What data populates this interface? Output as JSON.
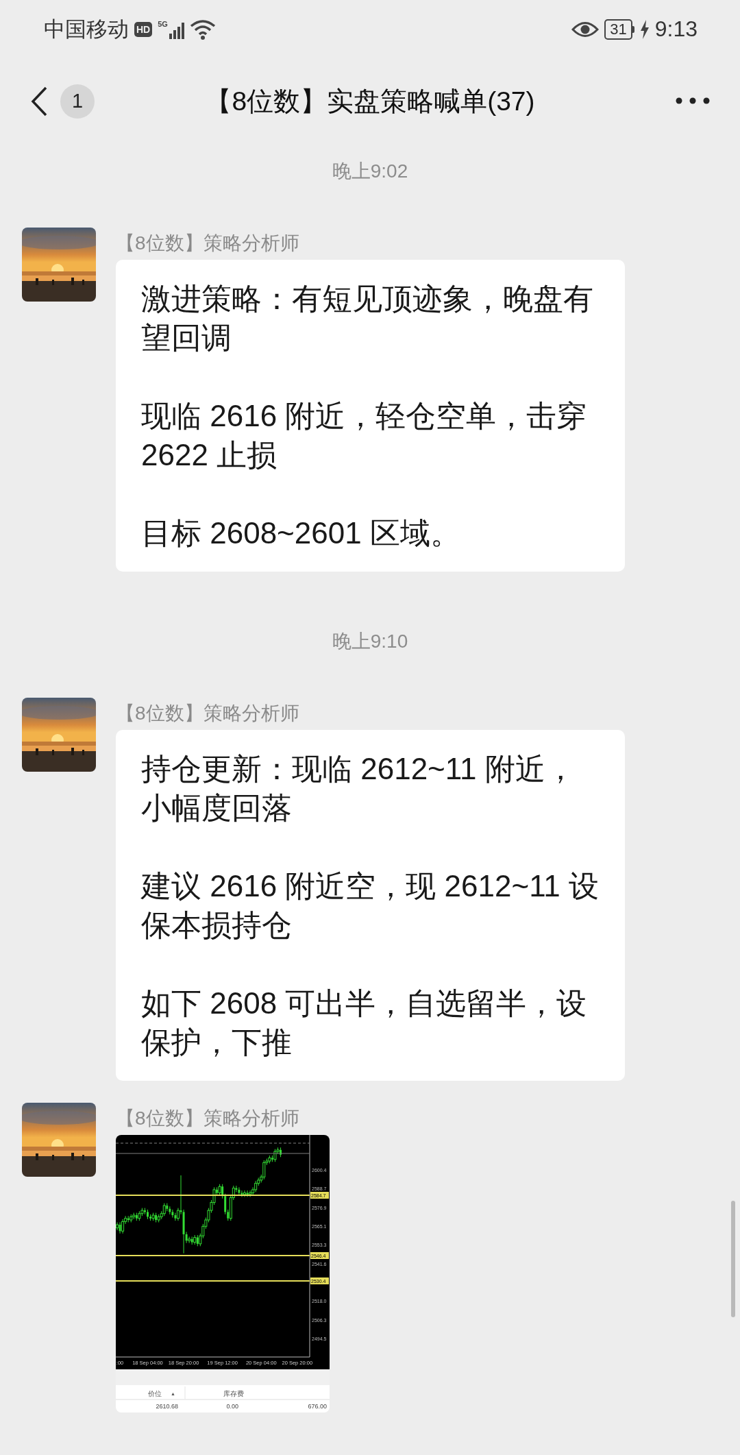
{
  "status_bar": {
    "carrier": "中国移动",
    "hd_badge": "HD",
    "network": "5G",
    "battery": "31",
    "time": "9:13"
  },
  "header": {
    "back_badge": "1",
    "title": "【8位数】实盘策略喊单(37)"
  },
  "messages": [
    {
      "kind": "time",
      "text": "晚上9:02"
    },
    {
      "kind": "text",
      "sender": "【8位数】策略分析师",
      "paragraphs": [
        "激进策略：有短见顶迹象，晚盘有望回调",
        "现临 2616 附近，轻仓空单，击穿 2622 止损",
        "目标 2608~2601 区域。"
      ]
    },
    {
      "kind": "time",
      "text": "晚上9:10"
    },
    {
      "kind": "text",
      "sender": "【8位数】策略分析师",
      "paragraphs": [
        "持仓更新：现临 2612~11 附近，小幅度回落",
        "建议 2616 附近空，现 2612~11 设保本损持仓",
        "如下 2608 可出半，自选留半，设保护，下推"
      ]
    },
    {
      "sender": "【8位数】策略分析师",
      "chart": {
        "chart_data": {
          "type": "candlestick",
          "categories": [
            null,
            ":00",
            null,
            null,
            null,
            null,
            null,
            null,
            null,
            null,
            null,
            "18 Sep 04:00",
            null,
            null,
            null,
            null,
            null,
            null,
            null,
            null,
            null,
            null,
            null,
            null,
            "18 Sep 20:00",
            null,
            null,
            null,
            null,
            null,
            null,
            null,
            null,
            null,
            null,
            null,
            null,
            null,
            "19 Sep 12:00",
            null,
            null,
            null,
            null,
            null,
            null,
            null,
            null,
            null,
            null,
            null,
            null,
            null,
            "20 Sep 04:00",
            null,
            null,
            null,
            null,
            null,
            null,
            null,
            null,
            null,
            null,
            null,
            null,
            "20 Sep 20:00",
            null,
            null,
            null,
            null
          ],
          "ohlc": [
            [
              2564,
              2567.5,
              2562.5,
              2566
            ],
            [
              2566,
              2567.5,
              2560.5,
              2562
            ],
            [
              2562,
              2569.5,
              2560.5,
              2568
            ],
            [
              2568,
              2571.5,
              2566.5,
              2570
            ],
            [
              2570,
              2571.5,
              2567.5,
              2569
            ],
            [
              2569,
              2572.5,
              2567.5,
              2571
            ],
            [
              2571,
              2573.5,
              2569.5,
              2572
            ],
            [
              2572,
              2573.5,
              2568.5,
              2570
            ],
            [
              2570,
              2574.5,
              2568.5,
              2573
            ],
            [
              2573,
              2576.5,
              2571.5,
              2575
            ],
            [
              2575,
              2576.5,
              2572.5,
              2574
            ],
            [
              2574,
              2575.5,
              2569.5,
              2571
            ],
            [
              2571,
              2572.5,
              2568.5,
              2570
            ],
            [
              2570,
              2573.5,
              2568.5,
              2572
            ],
            [
              2572,
              2573.5,
              2567.5,
              2569
            ],
            [
              2569,
              2572.5,
              2567.5,
              2571
            ],
            [
              2571,
              2574.5,
              2569.5,
              2573
            ],
            [
              2573,
              2579.5,
              2571.5,
              2578
            ],
            [
              2578,
              2579.5,
              2574.5,
              2576
            ],
            [
              2576,
              2577.5,
              2572.5,
              2574
            ],
            [
              2574,
              2575.5,
              2570.5,
              2572
            ],
            [
              2572,
              2573.5,
              2568.5,
              2570
            ],
            [
              2570,
              2576.5,
              2568.5,
              2575
            ],
            [
              2575,
              2597,
              2572.5,
              2574
            ],
            [
              2574,
              2575.5,
              2548,
              2560
            ],
            [
              2560,
              2561.5,
              2554.5,
              2556
            ],
            [
              2556,
              2558.5,
              2554.5,
              2557
            ],
            [
              2557,
              2558.5,
              2553.5,
              2555
            ],
            [
              2555,
              2559.5,
              2553.5,
              2558
            ],
            [
              2558,
              2559.5,
              2552.5,
              2554
            ],
            [
              2554,
              2560.5,
              2552.5,
              2559
            ],
            [
              2559,
              2566.5,
              2557.5,
              2565
            ],
            [
              2565,
              2570.5,
              2563.5,
              2569
            ],
            [
              2569,
              2576.5,
              2567.5,
              2575
            ],
            [
              2575,
              2581.5,
              2573.5,
              2580
            ],
            [
              2580,
              2589.5,
              2578.5,
              2588
            ],
            [
              2588,
              2589.5,
              2584.5,
              2586
            ],
            [
              2586,
              2591.5,
              2584.5,
              2590
            ],
            [
              2590,
              2591.5,
              2582.5,
              2584
            ],
            [
              2584,
              2585.5,
              2572.5,
              2574
            ],
            [
              2574,
              2575.5,
              2568.5,
              2570
            ],
            [
              2570,
              2584.5,
              2568.5,
              2583
            ],
            [
              2583,
              2590.5,
              2581.5,
              2589
            ],
            [
              2589,
              2590.5,
              2586.5,
              2588
            ],
            [
              2588,
              2589.5,
              2584.5,
              2586
            ],
            [
              2586,
              2587.5,
              2583.5,
              2585
            ],
            [
              2585,
              2587.5,
              2583.5,
              2586
            ],
            [
              2586,
              2587.5,
              2583.5,
              2585
            ],
            [
              2585,
              2587.5,
              2583.5,
              2586
            ],
            [
              2586,
              2589.5,
              2584.5,
              2588
            ],
            [
              2588,
              2593.5,
              2586.5,
              2592
            ],
            [
              2592,
              2595.5,
              2590.5,
              2594
            ],
            [
              2594,
              2597.5,
              2592.5,
              2596
            ],
            [
              2596,
              2606.5,
              2594.5,
              2605
            ],
            [
              2605,
              2607.5,
              2603.5,
              2606
            ],
            [
              2606,
              2609.5,
              2604.5,
              2608
            ],
            [
              2608,
              2609.5,
              2605.5,
              2607
            ],
            [
              2607,
              2613.5,
              2605.5,
              2612
            ],
            [
              2612,
              2614.5,
              2610.5,
              2613
            ],
            [
              2613,
              2614.5,
              2608.5,
              2610
            ],
            null,
            null,
            null,
            null,
            null,
            null,
            null,
            null,
            null,
            null
          ],
          "ylim": [
            2482.9,
            2622.4
          ],
          "yticks": [
            {
              "value": 2600.4,
              "label": "2600.4"
            },
            {
              "value": 2588.7,
              "label": "2588.7"
            },
            {
              "value": 2576.9,
              "label": "2576.9"
            },
            {
              "value": 2565.1,
              "label": "2565.1"
            },
            {
              "value": 2553.3,
              "label": "2553.3"
            },
            {
              "value": 2541.6,
              "label": "2541.6"
            },
            {
              "value": 2518.0,
              "label": "2518.0"
            },
            {
              "value": 2506.3,
              "label": "2506.3"
            },
            {
              "value": 2494.5,
              "label": "2494.5"
            }
          ]
        },
        "level_labels": [
          "2584.7",
          "2546.4",
          "2530.4"
        ],
        "columns": [
          "价位",
          "库存费"
        ],
        "sort_mark": "▲",
        "row": [
          "2610.68",
          "0.00",
          "676.00"
        ]
      }
    }
  ]
}
